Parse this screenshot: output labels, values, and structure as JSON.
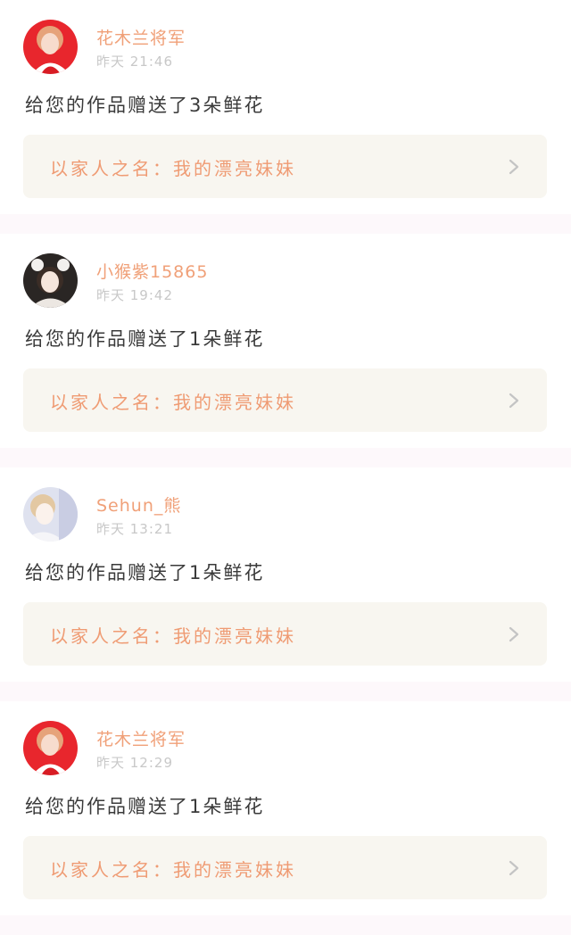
{
  "posts": [
    {
      "user": "花木兰将军",
      "time": "昨天 21:46",
      "message": "给您的作品赠送了3朵鲜花",
      "link": "以家人之名：我的漂亮妹妹",
      "avatar_icon": "red-dress-portrait"
    },
    {
      "user": "小猴紫15865",
      "time": "昨天 19:42",
      "message": "给您的作品赠送了1朵鲜花",
      "link": "以家人之名：我的漂亮妹妹",
      "avatar_icon": "girl-with-bear-ears-portrait"
    },
    {
      "user": "Sehun_熊",
      "time": "昨天 13:21",
      "message": "给您的作品赠送了1朵鲜花",
      "link": "以家人之名：我的漂亮妹妹",
      "avatar_icon": "soft-light-portrait"
    },
    {
      "user": "花木兰将军",
      "time": "昨天 12:29",
      "message": "给您的作品赠送了1朵鲜花",
      "link": "以家人之名：我的漂亮妹妹",
      "avatar_icon": "red-dress-portrait"
    }
  ],
  "colors": {
    "username": "#f0a078",
    "link_text": "#ef9b73",
    "link_bg": "#f8f6f0",
    "separator": "#fdf8fb"
  }
}
